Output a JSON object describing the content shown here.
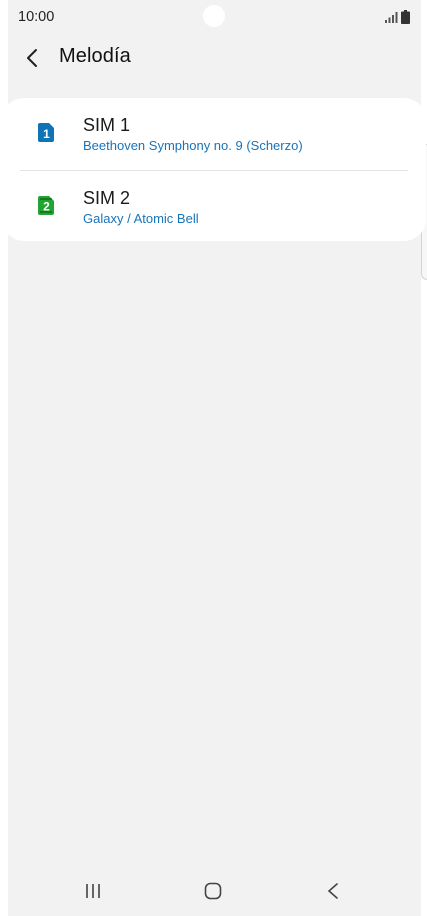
{
  "status_bar": {
    "time": "10:00"
  },
  "header": {
    "title": "Melodía"
  },
  "sims": [
    {
      "name": "SIM 1",
      "ringtone": "Beethoven Symphony no. 9 (Scherzo)",
      "badge": "1",
      "color": "#0f74b5"
    },
    {
      "name": "SIM 2",
      "ringtone": "Galaxy / Atomic Bell",
      "badge": "2",
      "color": "#22a334"
    }
  ],
  "colors": {
    "background": "#f2f2f2",
    "card": "#ffffff",
    "accent_text": "#1a73b8"
  }
}
